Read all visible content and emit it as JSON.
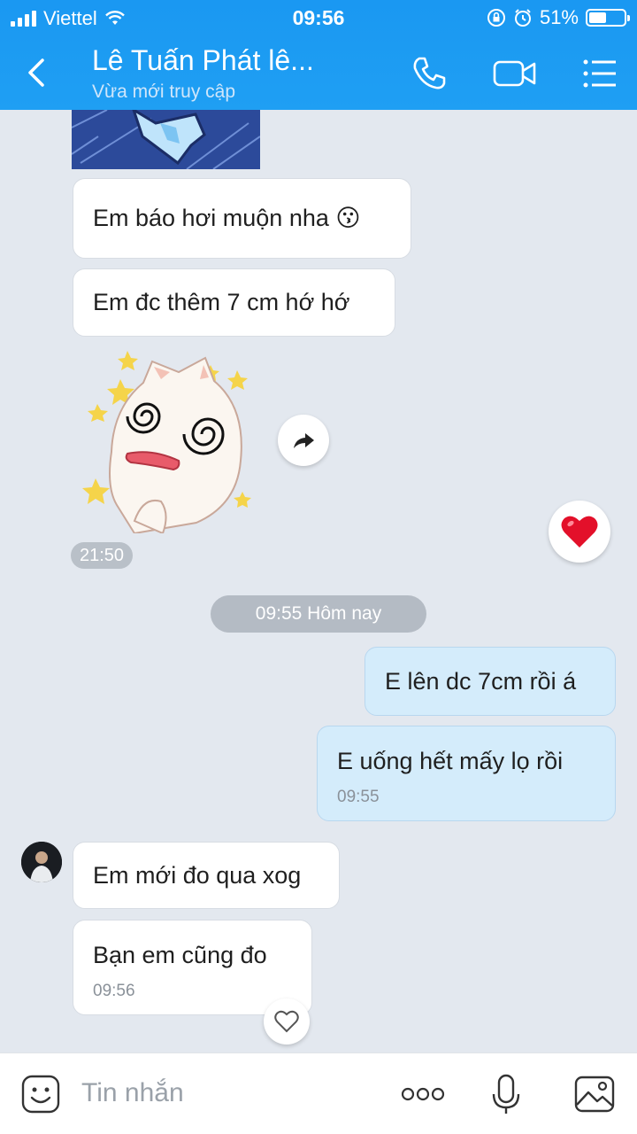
{
  "status": {
    "carrier": "Viettel",
    "time": "09:56",
    "battery": "51%"
  },
  "header": {
    "title": "Lê Tuấn Phát lê...",
    "subtitle": "Vừa mới truy cập"
  },
  "messages": {
    "m1": "Em báo hơi muộn nha 😗",
    "m2": "Em đc thêm 7 cm hớ hớ",
    "sticker_time": "21:50",
    "date_divider": "09:55 Hôm nay",
    "m3": "E lên dc 7cm rồi á",
    "m4": "E uống hết mấy lọ rồi",
    "m4_time": "09:55",
    "m5": "Em mới đo qua xog",
    "m6": "Bạn em cũng đo",
    "m6_time": "09:56",
    "heart_reaction": "❤️"
  },
  "input": {
    "placeholder": "Tin nhắn"
  },
  "colors": {
    "header": "#1c9bf0",
    "chat_bg": "#e3e8ef",
    "my_bubble": "#d4ecfb"
  }
}
